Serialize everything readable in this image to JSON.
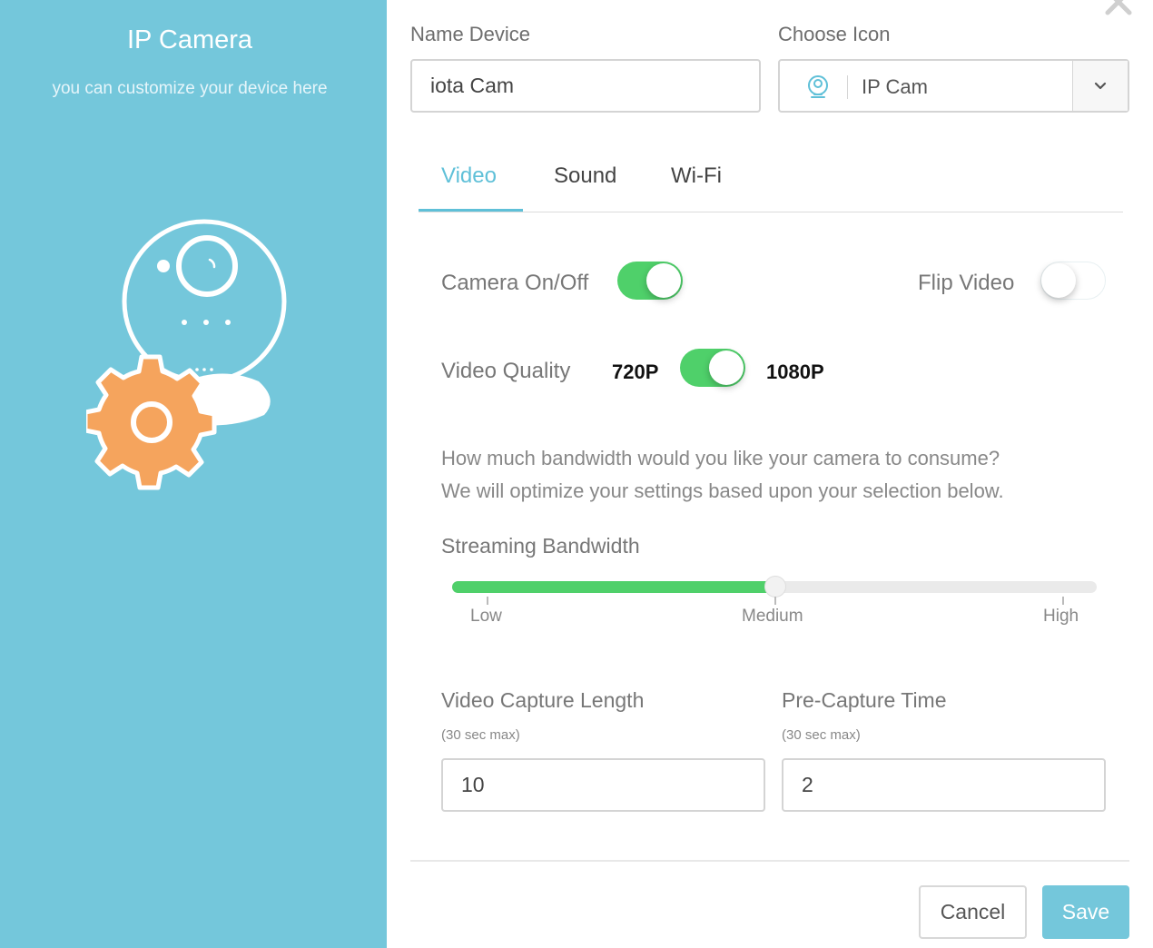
{
  "sidebar": {
    "title": "IP Camera",
    "subtitle": "you can customize your device here",
    "illustration_icon": "camera-settings-icon"
  },
  "name_device": {
    "label": "Name Device",
    "value": "iota Cam"
  },
  "choose_icon": {
    "label": "Choose Icon",
    "selected": "IP Cam",
    "icon": "ip-camera-icon"
  },
  "tabs": [
    {
      "label": "Video",
      "active": true
    },
    {
      "label": "Sound",
      "active": false
    },
    {
      "label": "Wi-Fi",
      "active": false
    }
  ],
  "video": {
    "camera_on_off": {
      "label": "Camera On/Off",
      "on": true
    },
    "flip_video": {
      "label": "Flip Video",
      "on": false
    },
    "video_quality": {
      "label": "Video Quality",
      "low": "720P",
      "high": "1080P",
      "on": true
    },
    "bandwidth_description_line1": "How much bandwidth would you like your camera to consume?",
    "bandwidth_description_line2": "We will optimize your settings based upon your selection below.",
    "streaming_bandwidth": {
      "label": "Streaming Bandwidth",
      "ticks": [
        "Low",
        "Medium",
        "High"
      ],
      "value_fraction": 0.5
    },
    "video_capture_length": {
      "label": "Video Capture Length",
      "note": "(30 sec max)",
      "value": "10"
    },
    "pre_capture_time": {
      "label": "Pre-Capture Time",
      "note": "(30 sec max)",
      "value": "2"
    }
  },
  "buttons": {
    "cancel": "Cancel",
    "save": "Save"
  },
  "colors": {
    "accent": "#74c7db",
    "toggle_on": "#4fd06a",
    "gear": "#f5a45d"
  }
}
